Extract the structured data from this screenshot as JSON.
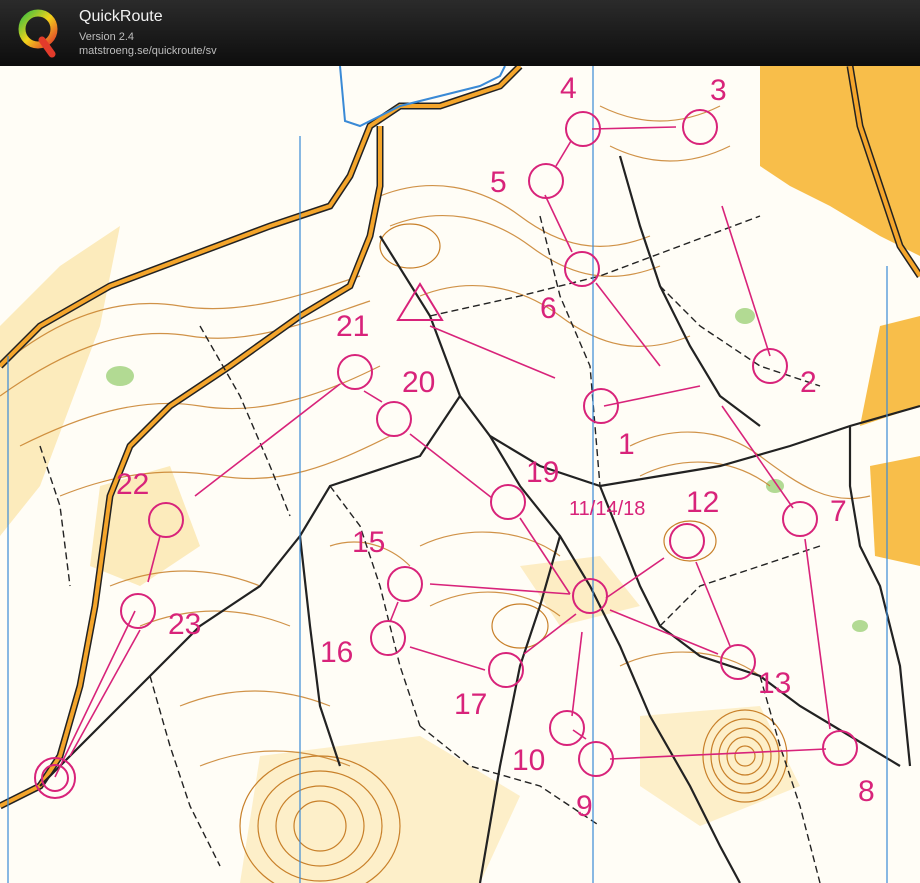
{
  "app": {
    "title": "QuickRoute",
    "version": "Version 2.4",
    "url": "matstroeng.se/quickroute/sv"
  },
  "map": {
    "type": "orienteering course map",
    "colors": {
      "course": "#d8237a",
      "contour": "#c8802a",
      "open_land": "#f7b32b",
      "rough_open": "#fbe3a4",
      "vegetation_green": "#9fd17a",
      "track": "#222222",
      "north_lines": "#3a8ad6",
      "water": "#3a8ad6"
    },
    "controls": [
      {
        "id": "start",
        "label": ""
      },
      {
        "id": "1",
        "label": "1"
      },
      {
        "id": "2",
        "label": "2"
      },
      {
        "id": "3",
        "label": "3"
      },
      {
        "id": "4",
        "label": "4"
      },
      {
        "id": "5",
        "label": "5"
      },
      {
        "id": "6",
        "label": "6"
      },
      {
        "id": "7",
        "label": "7"
      },
      {
        "id": "8",
        "label": "8"
      },
      {
        "id": "9",
        "label": "9"
      },
      {
        "id": "10",
        "label": "10"
      },
      {
        "id": "11_14_18",
        "label": "11/14/18"
      },
      {
        "id": "12",
        "label": "12"
      },
      {
        "id": "13",
        "label": "13"
      },
      {
        "id": "15",
        "label": "15"
      },
      {
        "id": "16",
        "label": "16"
      },
      {
        "id": "17",
        "label": "17"
      },
      {
        "id": "19",
        "label": "19"
      },
      {
        "id": "20",
        "label": "20"
      },
      {
        "id": "21",
        "label": "21"
      },
      {
        "id": "22",
        "label": "22"
      },
      {
        "id": "23",
        "label": "23"
      },
      {
        "id": "finish",
        "label": ""
      }
    ]
  }
}
